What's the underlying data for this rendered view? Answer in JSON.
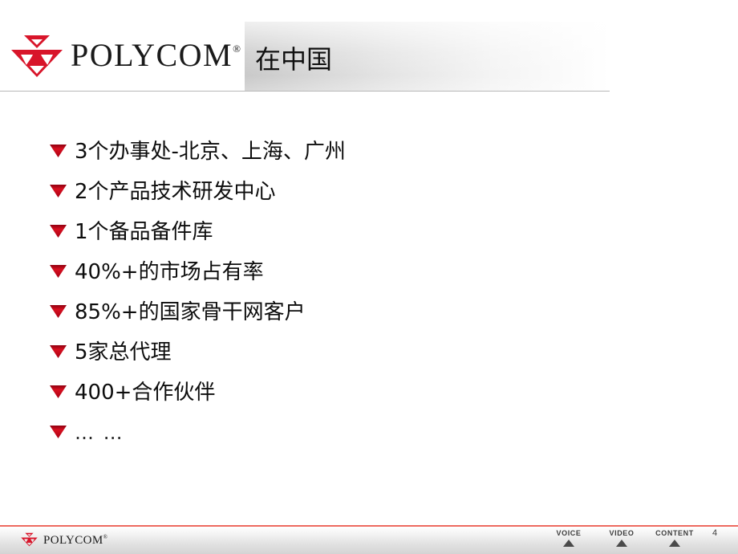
{
  "header": {
    "brand_name": "POLYCOM",
    "brand_reg": "®",
    "logo_icon": "polycom-triangles-logo",
    "title": "在中国",
    "band_color_start": "#c9c9c9",
    "band_color_end": "#ffffff",
    "logo_color": "#d8152a"
  },
  "body": {
    "bullet_icon": "down-triangle-bullet",
    "bullet_color": "#c00018",
    "items": [
      {
        "text": "3个办事处-北京、上海、广州"
      },
      {
        "text": "2个产品技术研发中心"
      },
      {
        "text": "1个备品备件库"
      },
      {
        "text": "40%+的市场占有率"
      },
      {
        "text": "85%+的国家骨干网客户"
      },
      {
        "text": "5家总代理"
      },
      {
        "text": "400+合作伙伴"
      },
      {
        "text": "… …"
      }
    ]
  },
  "footer": {
    "rule_color": "#ee6a60",
    "brand_name": "POLYCOM",
    "brand_reg": "®",
    "logo_icon": "polycom-triangles-logo-small",
    "pillars": [
      {
        "label": "VOICE",
        "icon": "up-triangle-marker"
      },
      {
        "label": "VIDEO",
        "icon": "up-triangle-marker"
      },
      {
        "label": "CONTENT",
        "icon": "up-triangle-marker"
      }
    ],
    "page_number": "4"
  }
}
